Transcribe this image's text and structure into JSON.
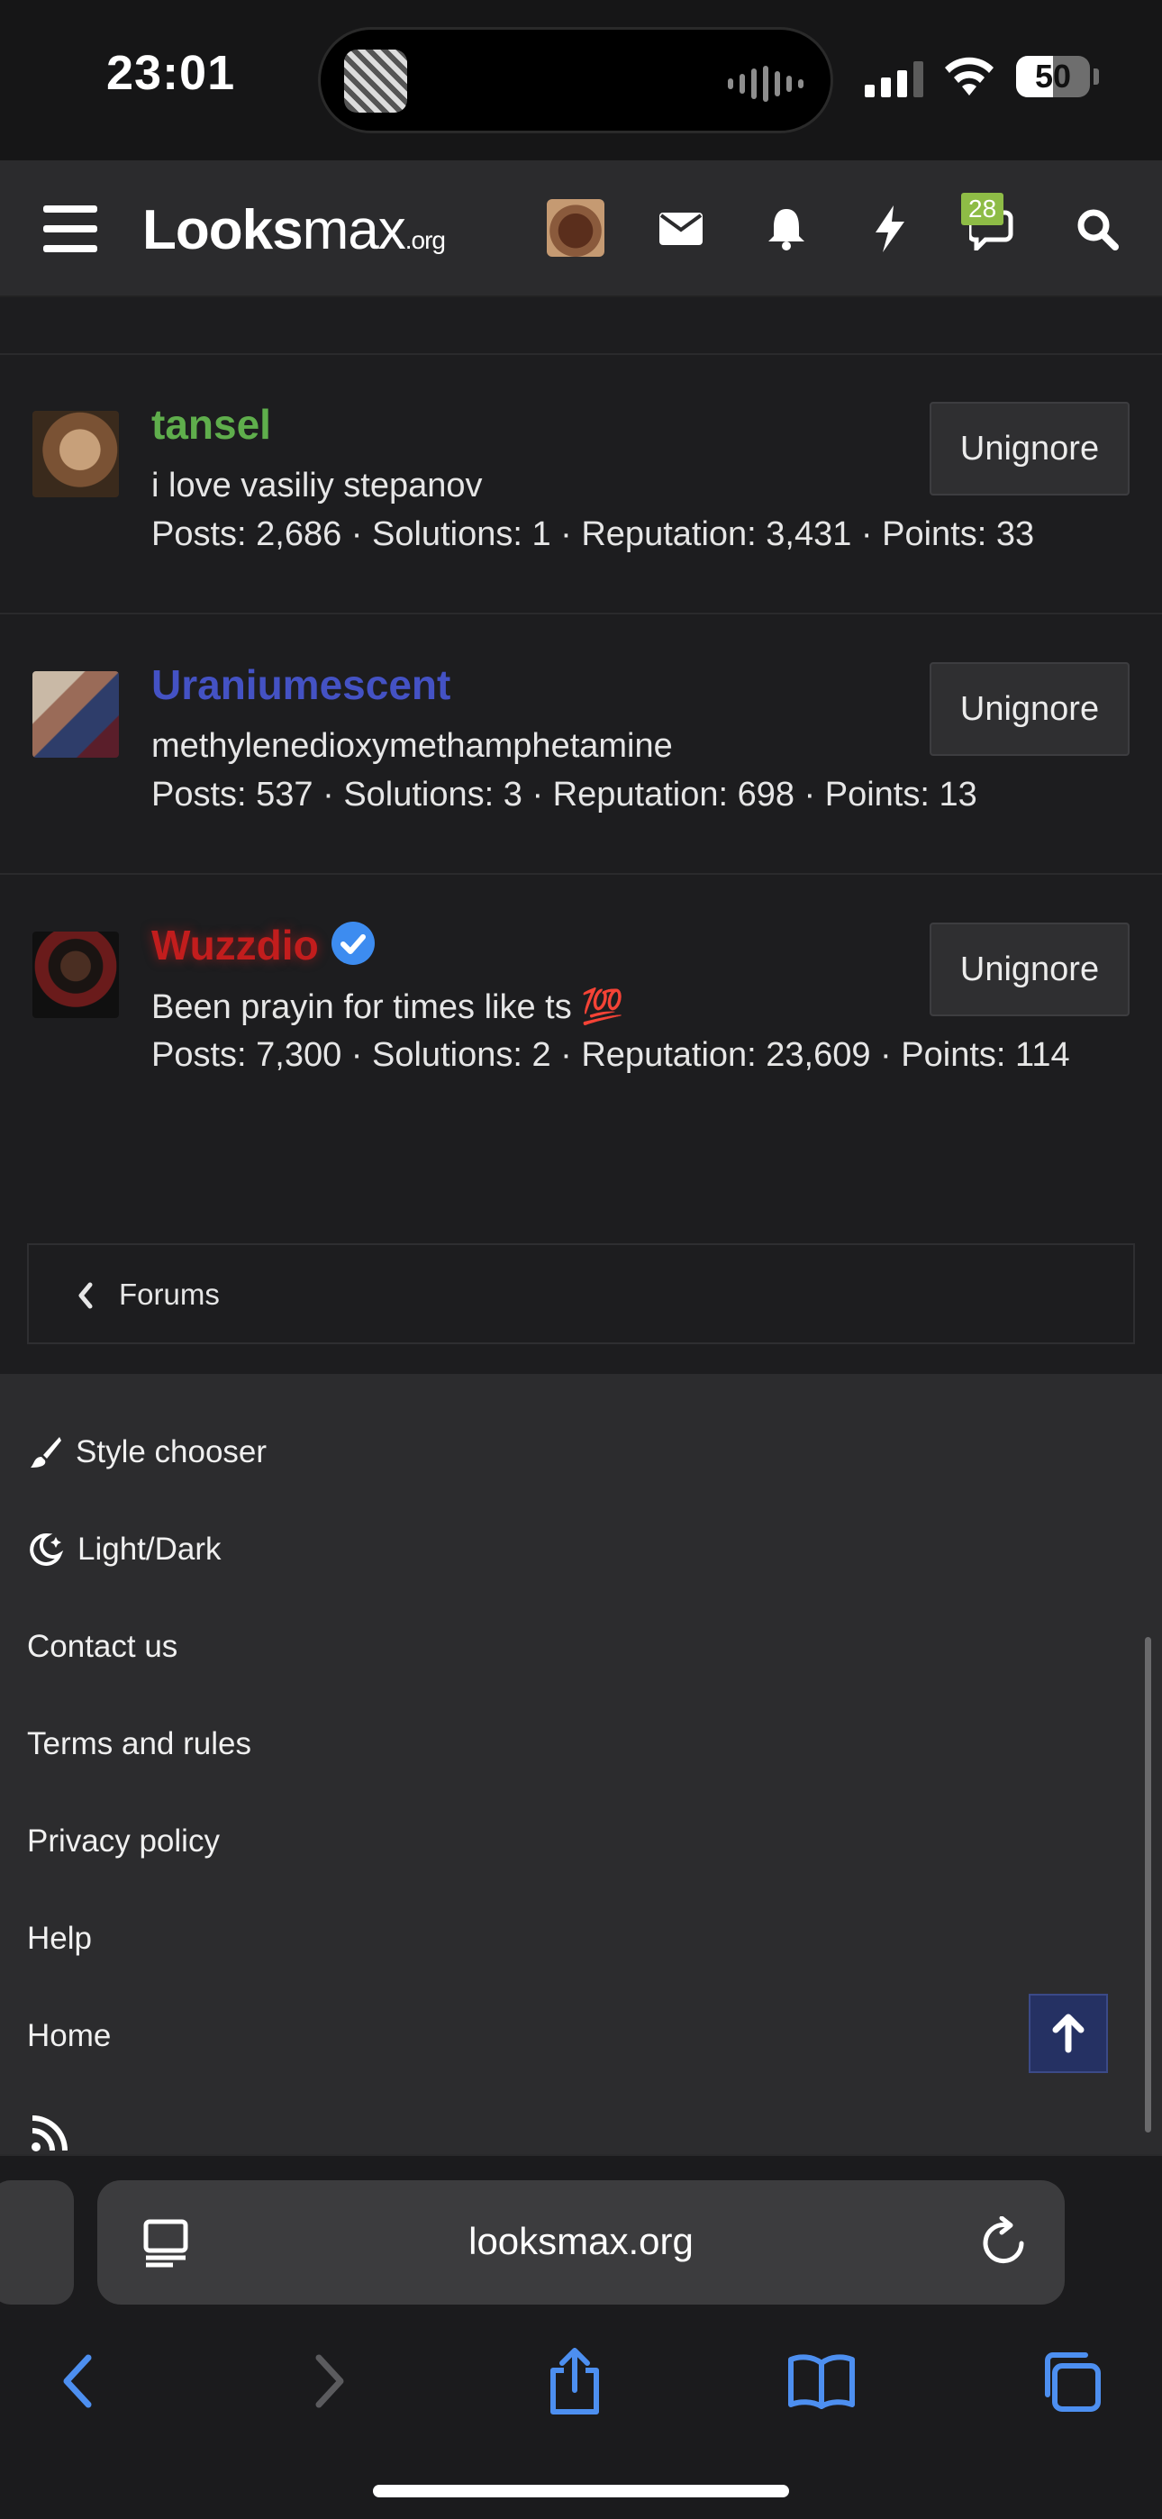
{
  "status_bar": {
    "time": "23:01",
    "battery": "50"
  },
  "header": {
    "logo_main": "Looks",
    "logo_sub": "max",
    "logo_tld": ".org",
    "conversations_badge": "28"
  },
  "members": [
    {
      "name": "tansel",
      "name_color": "#5fae4c",
      "status": "i love vasiliy stepanov",
      "stats": "Posts: 2,686 · Solutions: 1 · Reputation: 3,431 · Points: 33",
      "button_label": "Unignore",
      "verified": false
    },
    {
      "name": "Uraniumescent",
      "name_color": "#4452c4",
      "status": "methylenedioxymethamphetamine",
      "stats": "Posts: 537 · Solutions: 3 · Reputation: 698 · Points: 13",
      "button_label": "Unignore",
      "verified": false
    },
    {
      "name": "Wuzzdio",
      "name_color": "#c21d1d",
      "status": "Been prayin for times like ts 💯",
      "stats": "Posts: 7,300 · Solutions: 2 · Reputation: 23,609 · Points: 114",
      "button_label": "Unignore",
      "verified": true
    }
  ],
  "breadcrumb": {
    "label": "Forums"
  },
  "footer": {
    "style_chooser": "Style chooser",
    "light_dark": "Light/Dark",
    "contact": "Contact us",
    "terms": "Terms and rules",
    "privacy": "Privacy policy",
    "help": "Help",
    "home": "Home"
  },
  "safari": {
    "address": "looksmax.org"
  }
}
